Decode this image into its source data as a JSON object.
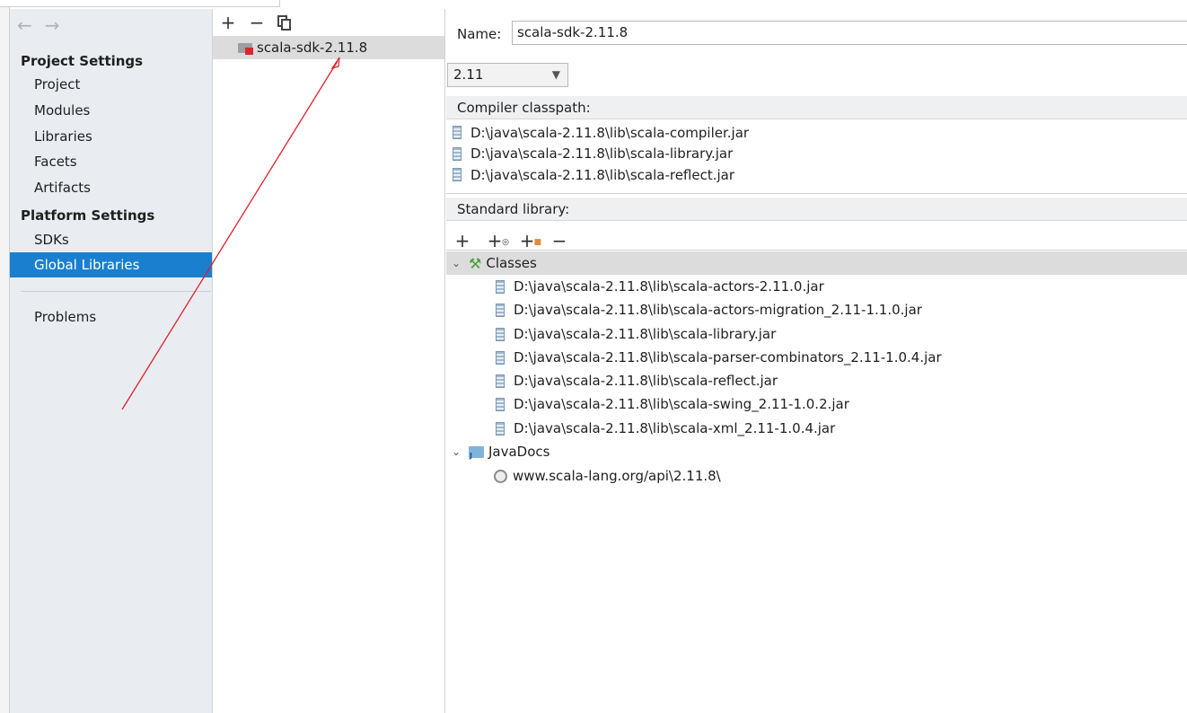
{
  "nav": {
    "back_icon": "arrow-left-icon",
    "forward_icon": "arrow-right-icon"
  },
  "sidebar": {
    "project_settings_title": "Project Settings",
    "project_items": [
      {
        "label": "Project"
      },
      {
        "label": "Modules"
      },
      {
        "label": "Libraries"
      },
      {
        "label": "Facets"
      },
      {
        "label": "Artifacts"
      }
    ],
    "platform_settings_title": "Platform Settings",
    "platform_items": [
      {
        "label": "SDKs"
      },
      {
        "label": "Global Libraries",
        "selected": true
      }
    ],
    "problems_label": "Problems"
  },
  "library_list": {
    "toolbar": {
      "add": "+",
      "remove": "−"
    },
    "items": [
      {
        "label": "scala-sdk-2.11.8",
        "selected": true
      }
    ]
  },
  "details": {
    "name_label": "Name:",
    "name_value": "scala-sdk-2.11.8",
    "version_value": "2.11",
    "compiler_classpath_label": "Compiler classpath:",
    "compiler_classpath": [
      "D:\\java\\scala-2.11.8\\lib\\scala-compiler.jar",
      "D:\\java\\scala-2.11.8\\lib\\scala-library.jar",
      "D:\\java\\scala-2.11.8\\lib\\scala-reflect.jar"
    ],
    "standard_library_label": "Standard library:",
    "std_toolbar": {
      "add": "+",
      "remove": "−"
    },
    "classes_label": "Classes",
    "classes": [
      "D:\\java\\scala-2.11.8\\lib\\scala-actors-2.11.0.jar",
      "D:\\java\\scala-2.11.8\\lib\\scala-actors-migration_2.11-1.1.0.jar",
      "D:\\java\\scala-2.11.8\\lib\\scala-library.jar",
      "D:\\java\\scala-2.11.8\\lib\\scala-parser-combinators_2.11-1.0.4.jar",
      "D:\\java\\scala-2.11.8\\lib\\scala-reflect.jar",
      "D:\\java\\scala-2.11.8\\lib\\scala-swing_2.11-1.0.2.jar",
      "D:\\java\\scala-2.11.8\\lib\\scala-xml_2.11-1.0.4.jar"
    ],
    "javadocs_label": "JavaDocs",
    "javadocs": [
      "www.scala-lang.org/api\\2.11.8\\"
    ]
  },
  "colors": {
    "selection": "#1a7fcf",
    "sidebar_bg": "#e9edf2",
    "annotation": "#e0202a"
  }
}
